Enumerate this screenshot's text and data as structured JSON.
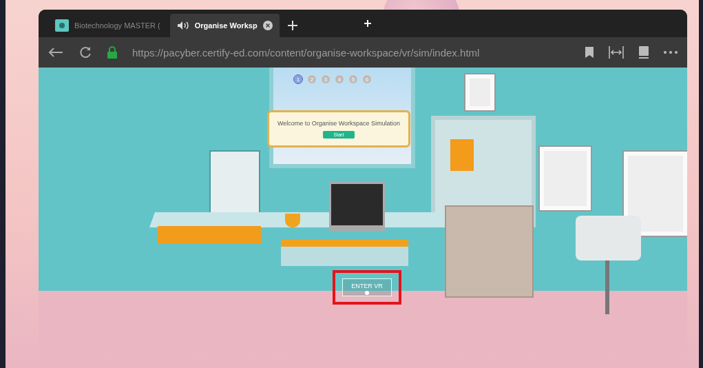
{
  "tabs": [
    {
      "label": "Biotechnology MASTER (",
      "selected": false,
      "kind": "app"
    },
    {
      "label": "Organise Worksp",
      "selected": true,
      "kind": "audio"
    }
  ],
  "address_bar": {
    "url": "https://pacyber.certify-ed.com/content/organise-workspace/vr/sim/index.html"
  },
  "scene": {
    "steps": [
      {
        "label": "1",
        "selected": true
      },
      {
        "label": "2",
        "selected": false
      },
      {
        "label": "3",
        "selected": false
      },
      {
        "label": "4",
        "selected": false
      },
      {
        "label": "5",
        "selected": false
      },
      {
        "label": "6",
        "selected": false
      }
    ],
    "welcome_message": "Welcome to Organise Workspace Simulation",
    "start_button": "Start",
    "enter_vr_button": "ENTER VR",
    "enter_vr_highlighted": true
  }
}
